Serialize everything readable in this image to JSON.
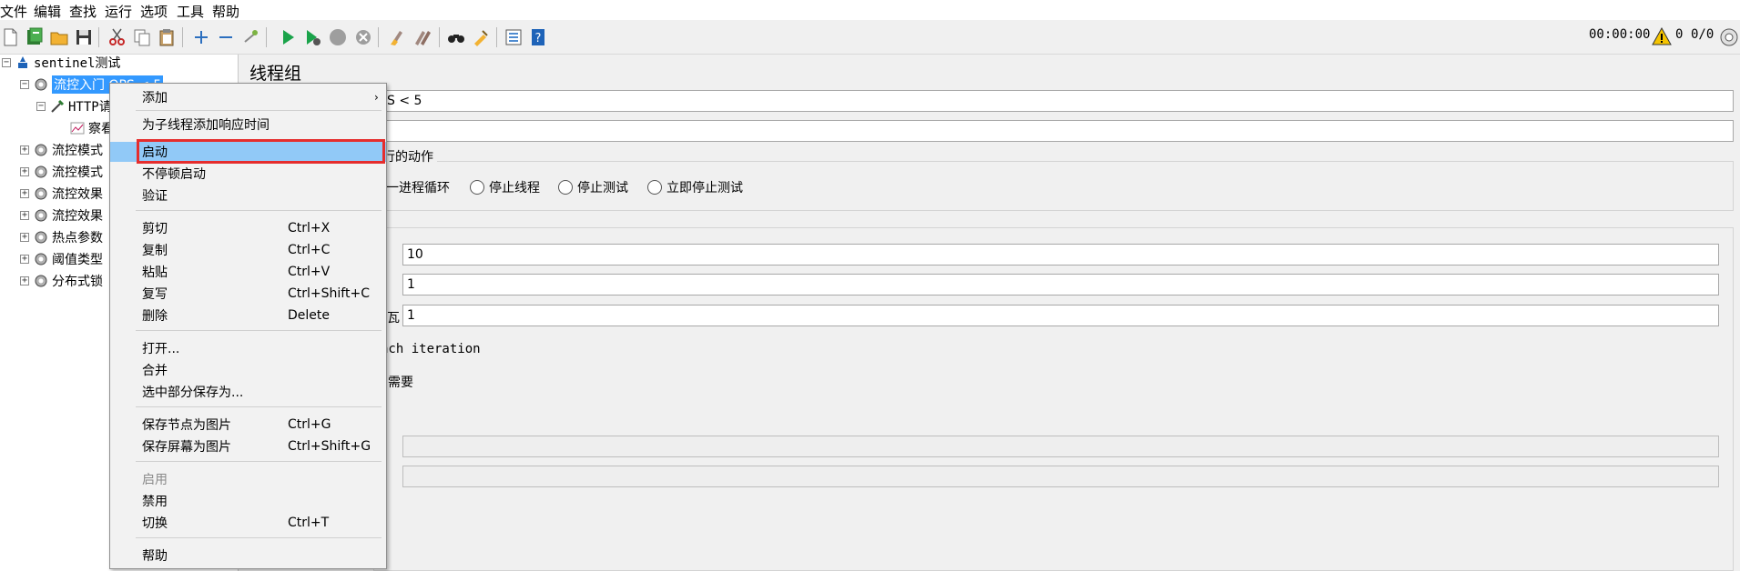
{
  "menubar": [
    "文件",
    "编辑",
    "查找",
    "运行",
    "选项",
    "工具",
    "帮助"
  ],
  "toolbar": {
    "icons": [
      "new-icon",
      "templates-icon",
      "open-icon",
      "save-icon",
      "cut-icon",
      "copy-icon",
      "paste-icon",
      "expand-icon",
      "collapse-icon",
      "toggle-icon",
      "start-icon",
      "start-no-pause-icon",
      "stop-icon",
      "shutdown-icon",
      "clear-icon",
      "clear-all-icon",
      "search-icon",
      "reset-search-icon",
      "function-helper-icon",
      "help-icon"
    ],
    "timer": "00:00:00",
    "warning_count": "0",
    "threads": "0/0"
  },
  "tree": {
    "root": "sentinel测试",
    "selected": "流控入门 QPS < 5",
    "http_request": "HTTP请",
    "listener": "察看",
    "items": [
      "流控模式",
      "流控模式",
      "流控效果",
      "流控效果",
      "热点参数",
      "阈值类型",
      "分布式锁"
    ]
  },
  "panel": {
    "title": "线程组",
    "name_value": "S < 5",
    "action_label": "行的动作",
    "radio_1": "一进程循环",
    "radio_2": "停止线程",
    "radio_3": "停止测试",
    "radio_4": "立即停止测试",
    "threads_value": "10",
    "rampup_value": "1",
    "loop_value": "1",
    "loop_label_partial": "瓦",
    "same_user_text": "ach iteration",
    "delay_text": "到需要"
  },
  "context_menu": {
    "add": "添加",
    "add_response_time": "为子线程添加响应时间",
    "start": "启动",
    "start_no_pause": "不停顿启动",
    "validate": "验证",
    "cut": "剪切",
    "cut_key": "Ctrl+X",
    "copy": "复制",
    "copy_key": "Ctrl+C",
    "paste": "粘贴",
    "paste_key": "Ctrl+V",
    "duplicate": "复写",
    "duplicate_key": "Ctrl+Shift+C",
    "delete": "删除",
    "delete_key": "Delete",
    "open": "打开...",
    "merge": "合并",
    "save_selection": "选中部分保存为...",
    "save_node_image": "保存节点为图片",
    "save_node_image_key": "Ctrl+G",
    "save_screen_image": "保存屏幕为图片",
    "save_screen_image_key": "Ctrl+Shift+G",
    "enable": "启用",
    "disable": "禁用",
    "toggle": "切换",
    "toggle_key": "Ctrl+T",
    "help": "帮助"
  },
  "colors": {
    "selection": "#3399ff",
    "menu_highlight": "#91c9f7",
    "annotation_box": "#e52d2d",
    "start_green": "#1aa34a"
  }
}
